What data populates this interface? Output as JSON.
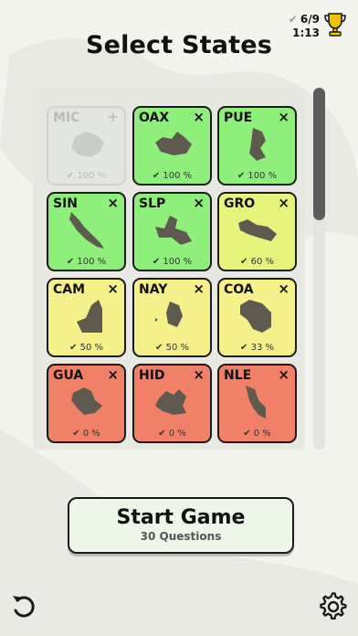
{
  "header": {
    "title": "Select States"
  },
  "status": {
    "progress": "6/9",
    "timer": "1:13"
  },
  "colors": {
    "green": "#8ef07a",
    "light_yellow": "#e6f47c",
    "yellow": "#f5f08a",
    "red": "#f08068",
    "shape": "#5e5a50"
  },
  "states": [
    {
      "code": "MIC",
      "action": "+",
      "percent": "100 %",
      "color": "#e3e6e0",
      "disabled": true
    },
    {
      "code": "OAX",
      "action": "×",
      "percent": "100 %",
      "color": "#8ef07a",
      "disabled": false
    },
    {
      "code": "PUE",
      "action": "×",
      "percent": "100 %",
      "color": "#8ef07a",
      "disabled": false
    },
    {
      "code": "SIN",
      "action": "×",
      "percent": "100 %",
      "color": "#8ef07a",
      "disabled": false
    },
    {
      "code": "SLP",
      "action": "×",
      "percent": "100 %",
      "color": "#8ef07a",
      "disabled": false
    },
    {
      "code": "GRO",
      "action": "×",
      "percent": "60 %",
      "color": "#e6f47c",
      "disabled": false
    },
    {
      "code": "CAM",
      "action": "×",
      "percent": "50 %",
      "color": "#f5f08a",
      "disabled": false
    },
    {
      "code": "NAY",
      "action": "×",
      "percent": "50 %",
      "color": "#f5f08a",
      "disabled": false
    },
    {
      "code": "COA",
      "action": "×",
      "percent": "33 %",
      "color": "#f5f08a",
      "disabled": false
    },
    {
      "code": "GUA",
      "action": "×",
      "percent": "0 %",
      "color": "#f08068",
      "disabled": false
    },
    {
      "code": "HID",
      "action": "×",
      "percent": "0 %",
      "color": "#f08068",
      "disabled": false
    },
    {
      "code": "NLE",
      "action": "×",
      "percent": "0 %",
      "color": "#f08068",
      "disabled": false
    }
  ],
  "start_button": {
    "label": "Start Game",
    "sublabel": "30 Questions"
  },
  "icons": {
    "check": "check-icon",
    "trophy": "trophy-icon",
    "back": "undo-icon",
    "settings": "gear-icon"
  }
}
